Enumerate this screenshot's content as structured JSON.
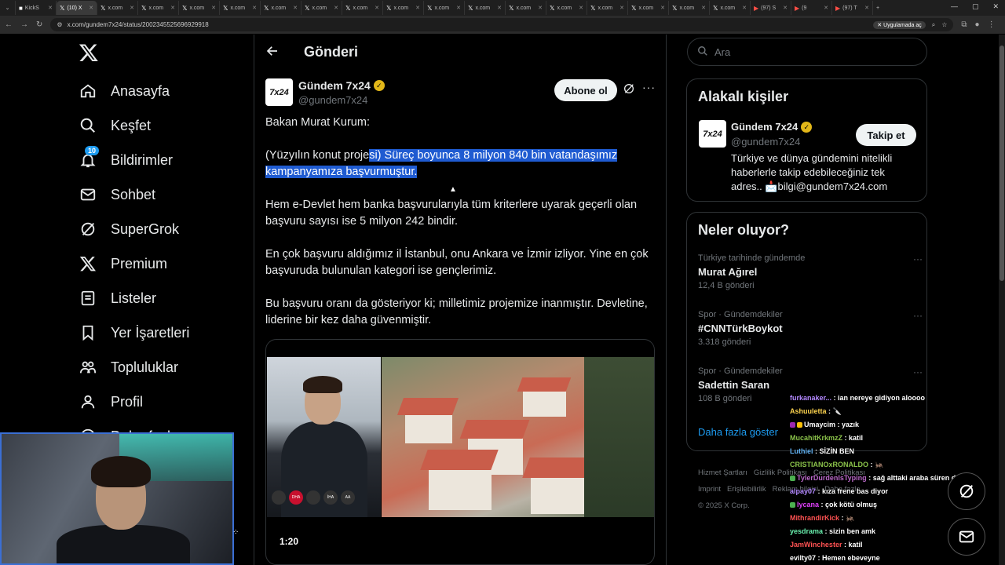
{
  "browser": {
    "tabs": [
      {
        "label": "KickS",
        "icon": "kick"
      },
      {
        "label": "(10) X",
        "icon": "x",
        "active": true
      },
      {
        "label": "x.com",
        "icon": "x"
      },
      {
        "label": "x.com",
        "icon": "x"
      },
      {
        "label": "x.com",
        "icon": "x"
      },
      {
        "label": "x.com",
        "icon": "x"
      },
      {
        "label": "x.com",
        "icon": "x"
      },
      {
        "label": "x.com",
        "icon": "x"
      },
      {
        "label": "x.com",
        "icon": "x"
      },
      {
        "label": "x.com",
        "icon": "x"
      },
      {
        "label": "x.com",
        "icon": "x"
      },
      {
        "label": "x.com",
        "icon": "x"
      },
      {
        "label": "x.com",
        "icon": "x"
      },
      {
        "label": "x.com",
        "icon": "x"
      },
      {
        "label": "x.com",
        "icon": "x"
      },
      {
        "label": "x.com",
        "icon": "x"
      },
      {
        "label": "x.com",
        "icon": "x"
      },
      {
        "label": "x.com",
        "icon": "x"
      },
      {
        "label": "(97) S",
        "icon": "youtube"
      },
      {
        "label": "(9",
        "icon": "youtube"
      },
      {
        "label": "(97) T",
        "icon": "youtube"
      }
    ],
    "url": "x.com/gundem7x24/status/2002345525696929918",
    "open_in_app": "Uygulamada aç"
  },
  "sidebar": {
    "items": [
      {
        "label": "Anasayfa",
        "icon": "home-icon"
      },
      {
        "label": "Keşfet",
        "icon": "search-icon"
      },
      {
        "label": "Bildirimler",
        "icon": "bell-icon",
        "badge": "10"
      },
      {
        "label": "Sohbet",
        "icon": "mail-icon"
      },
      {
        "label": "SuperGrok",
        "icon": "grok-icon"
      },
      {
        "label": "Premium",
        "icon": "x-icon"
      },
      {
        "label": "Listeler",
        "icon": "list-icon"
      },
      {
        "label": "Yer İşaretleri",
        "icon": "bookmark-icon"
      },
      {
        "label": "Topluluklar",
        "icon": "people-icon"
      },
      {
        "label": "Profil",
        "icon": "person-icon"
      },
      {
        "label": "Daha fazla",
        "icon": "more-circle-icon"
      }
    ]
  },
  "main": {
    "title": "Gönderi",
    "author": {
      "name": "Gündem 7x24",
      "handle": "@gundem7x24",
      "avatar_text": "7x24"
    },
    "subscribe_label": "Abone ol",
    "post": {
      "p1": "Bakan Murat Kurum:",
      "p2_plain": "(Yüzyılın konut proje",
      "p2_highlight": "si) Süreç boyunca 8 milyon 840 bin  vatandaşımız kampanyamıza başvurmuştur. ",
      "p3": "Hem e-Devlet hem banka başvurularıyla tüm kriterlere uyarak geçerli olan başvuru sayısı ise 5 milyon 242 bindir.",
      "p4": "En çok başvuru aldığımız il İstanbul, onu Ankara ve İzmir izliyor. Yine en çok başvuruda bulunulan kategori ise gençlerimiz.",
      "p5": "Bu başvuru oranı da gösteriyor ki; milletimiz projemize inanmıştır. Devletine, liderine bir kez daha güvenmiştir."
    },
    "video_time": "1:20",
    "mic_labels": [
      "",
      "DHA",
      "",
      "İHA",
      "AA"
    ]
  },
  "right": {
    "search_placeholder": "Ara",
    "related": {
      "title": "Alakalı kişiler",
      "name": "Gündem 7x24",
      "handle": "@gundem7x24",
      "follow_label": "Takip et",
      "bio": "Türkiye ve dünya gündemini nitelikli haberlerle takip edebileceğiniz tek adres.. 📩bilgi@gundem7x24.com"
    },
    "trends": {
      "title": "Neler oluyor?",
      "items": [
        {
          "context": "Türkiye tarihinde gündemde",
          "name": "Murat Ağırel",
          "count": "12,4 B gönderi"
        },
        {
          "context": "Spor · Gündemdekiler",
          "name": "#CNNTürkBoykot",
          "count": "3.318 gönderi"
        },
        {
          "context": "Spor · Gündemdekiler",
          "name": "Sadettin Saran",
          "count": "108 B gönderi"
        }
      ],
      "show_more": "Daha fazla göster"
    },
    "footer": {
      "line1": [
        "Hizmet Şartları",
        "Gizlilik Politikası",
        "Çerez Politikası"
      ],
      "line2": [
        "Imprint",
        "Erişilebilirlik",
        "Reklam bilgisi",
        "Daha fazla ..."
      ],
      "copyright": "© 2025 X Corp."
    }
  },
  "chat": [
    {
      "user": "furkanaker...",
      "color": "#b388ff",
      "msg": "ian nereye gidiyon aloooo"
    },
    {
      "user": "Ashuuletta",
      "color": "#ffd54f",
      "msg": "🔪"
    },
    {
      "user": "Umaycim",
      "color": "#ffffff",
      "msg": "yazık",
      "badges": [
        "#9c27b0",
        "#ffc107"
      ]
    },
    {
      "user": "MucahitKrkmzZ",
      "color": "#8bc34a",
      "msg": "katil"
    },
    {
      "user": "Luthiel",
      "color": "#64b5f6",
      "msg": "SİZİN BEN"
    },
    {
      "user": "CRISTIANOxRONALDO",
      "color": "#8bc34a",
      "msg": "🦗"
    },
    {
      "user": "TylerDurdenIsTyping",
      "color": "#ba68c8",
      "msg": "sağ alttaki araba süren değil",
      "badges": [
        "#4caf50"
      ]
    },
    {
      "user": "alpay07",
      "color": "#b388ff",
      "msg": "kıza frene bas diyor"
    },
    {
      "user": "lycana",
      "color": "#e040fb",
      "msg": "çok kötü olmuş",
      "badges": [
        "#4caf50"
      ]
    },
    {
      "user": "MithrandirKick",
      "color": "#ff5252",
      "msg": "🦗"
    },
    {
      "user": "yesdrama",
      "color": "#69f0ae",
      "msg": "sizin ben amk"
    },
    {
      "user": "JamWinchester",
      "color": "#ff5252",
      "msg": "katil"
    },
    {
      "user": "evilty07",
      "color": "#ffffff",
      "msg": "Hemen ebeveyne"
    }
  ],
  "colors": {
    "accent": "#1d9bf0",
    "highlight": "#1f5bd1",
    "background": "#000000"
  }
}
